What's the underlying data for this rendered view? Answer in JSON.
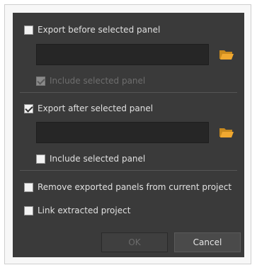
{
  "dialog": {
    "export_before": {
      "label": "Export before selected panel",
      "checked": false
    },
    "before_include": {
      "label": "Include selected panel",
      "checked": true,
      "disabled": true
    },
    "export_after": {
      "label": "Export after selected panel",
      "checked": true
    },
    "after_include": {
      "label": "Include selected panel",
      "checked": false
    },
    "remove_exported": {
      "label": "Remove exported panels from current project",
      "checked": false
    },
    "link_extracted": {
      "label": "Link extracted project",
      "checked": false
    },
    "ok_label": "OK",
    "cancel_label": "Cancel"
  },
  "icons": {
    "folder": "folder-open-icon"
  },
  "colors": {
    "folder_accent": "#f0a830",
    "dialog_bg": "#3a3a3a"
  }
}
